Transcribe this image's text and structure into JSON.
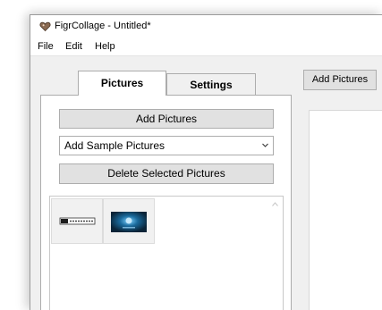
{
  "window": {
    "title": "FigrCollage - Untitled*"
  },
  "menu": {
    "items": [
      "File",
      "Edit",
      "Help"
    ]
  },
  "tabs": [
    {
      "label": "Pictures",
      "active": true
    },
    {
      "label": "Settings",
      "active": false
    }
  ],
  "pictures_panel": {
    "add_button": "Add Pictures",
    "sample_select": {
      "selected": "Add Sample Pictures"
    },
    "delete_button": "Delete Selected Pictures",
    "thumbnails": [
      {
        "icon": "logo-thumbnail"
      },
      {
        "icon": "blue-artwork-thumbnail"
      }
    ]
  },
  "toolbar": {
    "add_pictures_label": "Add Pictures"
  },
  "colors": {
    "window_bg": "#f0f0f0",
    "button_bg": "#e1e1e1",
    "border": "#acacac",
    "thumb_blue": "#0f4d78"
  }
}
